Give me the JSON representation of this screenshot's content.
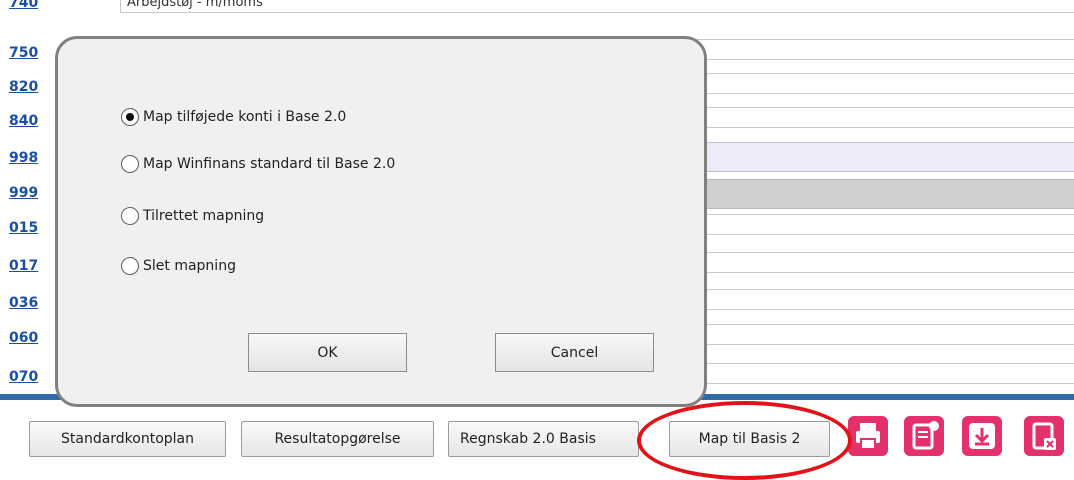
{
  "background_rows": [
    {
      "code": "740",
      "field": "Arbejdstøj - m/moms",
      "style": "plain"
    },
    {
      "code": "750",
      "field": "",
      "style": "plain"
    },
    {
      "code": "820",
      "field": "",
      "style": "plain"
    },
    {
      "code": "840",
      "field": "",
      "style": "plain"
    },
    {
      "code": "998",
      "field": "",
      "style": "lav"
    },
    {
      "code": "999",
      "field": "",
      "style": "gray"
    },
    {
      "code": "015",
      "field": "",
      "style": "plain"
    },
    {
      "code": "017",
      "field": "",
      "style": "plain"
    },
    {
      "code": "036",
      "field": "",
      "style": "plain"
    },
    {
      "code": "060",
      "field": "",
      "style": "plain"
    },
    {
      "code": "070",
      "field": "",
      "style": "plain"
    }
  ],
  "dialog": {
    "options": [
      {
        "label": "Map tilføjede konti i Base 2.0",
        "checked": true
      },
      {
        "label": "Map Winfinans standard til Base 2.0",
        "checked": false
      },
      {
        "label": "Tilrettet mapning",
        "checked": false
      },
      {
        "label": "Slet mapning",
        "checked": false
      }
    ],
    "ok_label": "OK",
    "cancel_label": "Cancel"
  },
  "toolbar": {
    "buttons": [
      {
        "name": "standardkontoplan-button",
        "label": "Standardkontoplan"
      },
      {
        "name": "resultatopgorelse-button",
        "label": "Resultatopgørelse"
      },
      {
        "name": "regnskab-basis-button",
        "label": "Regnskab 2.0 Basis"
      },
      {
        "name": "map-til-basis-button",
        "label": "Map til Basis 2"
      }
    ],
    "icons": [
      "print-icon",
      "new-document-icon",
      "download-icon",
      "close-document-icon"
    ],
    "icon_color": "#e5316b",
    "highlight_color": "#e11218"
  }
}
